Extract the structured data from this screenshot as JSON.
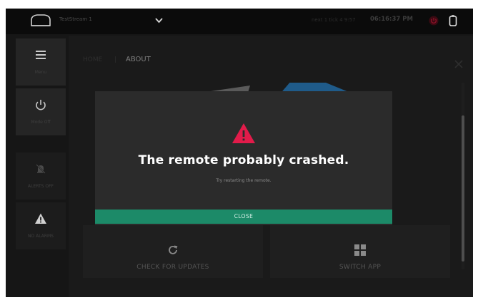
{
  "topbar": {
    "device_name": "TestStream 1",
    "status_text": "next 1 tick 4 9:57",
    "time": "06:16:37 PM"
  },
  "sidebar": {
    "items": [
      {
        "label": "Menu",
        "icon": "hamburger-menu-icon"
      },
      {
        "label": "Mode Off",
        "icon": "power-icon"
      },
      {
        "label": "ALERTS OFF",
        "icon": "bell-off-icon"
      },
      {
        "label": "NO ALARMS",
        "icon": "warning-icon"
      }
    ]
  },
  "main": {
    "breadcrumb_home": "HOME",
    "breadcrumb_sep": "|",
    "breadcrumb_current": "ABOUT",
    "tiles": [
      {
        "label": "CHECK FOR UPDATES",
        "icon": "refresh-icon"
      },
      {
        "label": "SWITCH APP",
        "icon": "grid-icon"
      }
    ]
  },
  "modal": {
    "title": "The remote probably crashed.",
    "subtitle": "Try restarting the remote.",
    "close_label": "CLOSE"
  },
  "colors": {
    "accent_green": "#1c8a68",
    "warning_red": "#e21b4a",
    "background": "#161616"
  }
}
